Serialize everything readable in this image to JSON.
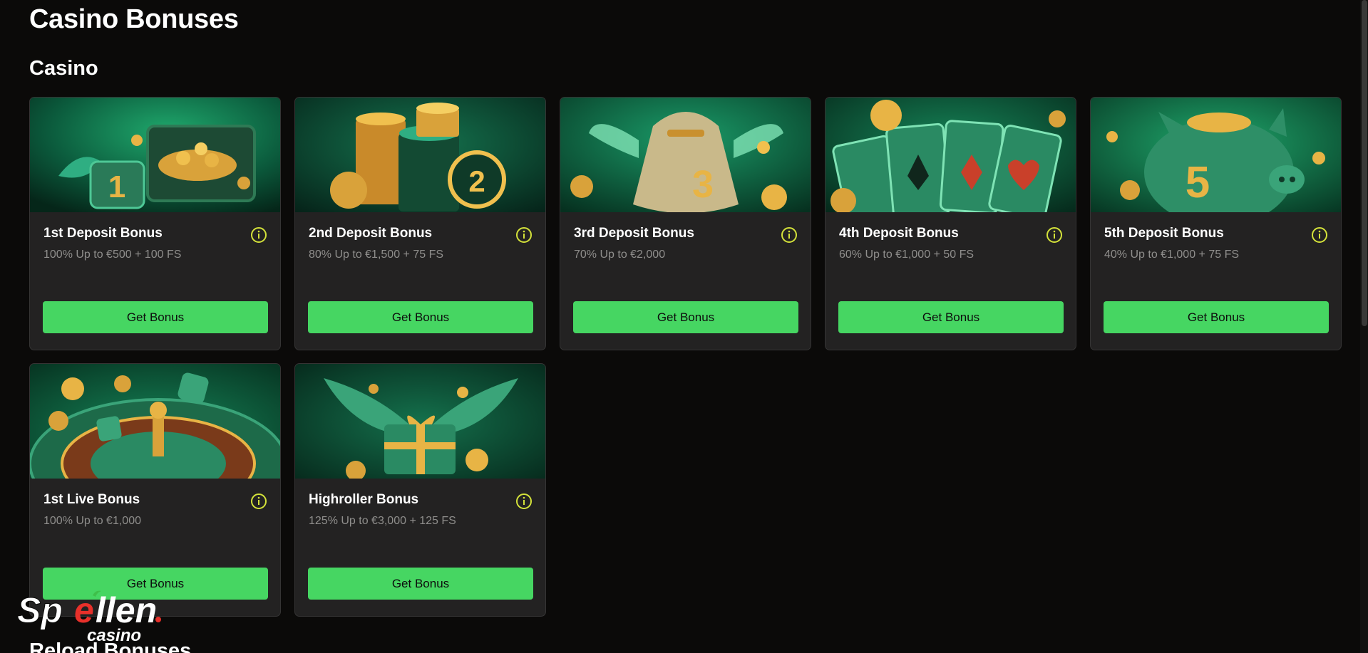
{
  "page": {
    "title": "Casino Bonuses",
    "section_casino": "Casino",
    "section_reload": "Reload Bonuses"
  },
  "cards": [
    {
      "name": "1st Deposit Bonus",
      "description": "100% Up to €500 + 100 FS",
      "button": "Get Bonus",
      "image_digit": "1",
      "info_icon": "info-icon"
    },
    {
      "name": "2nd Deposit Bonus",
      "description": "80% Up to €1,500 + 75 FS",
      "button": "Get Bonus",
      "image_digit": "2",
      "info_icon": "info-icon"
    },
    {
      "name": "3rd Deposit Bonus",
      "description": "70% Up to €2,000",
      "button": "Get Bonus",
      "image_digit": "3",
      "info_icon": "info-icon"
    },
    {
      "name": "4th Deposit Bonus",
      "description": "60% Up to €1,000 + 50 FS",
      "button": "Get Bonus",
      "image_digit": "",
      "info_icon": "info-icon"
    },
    {
      "name": "5th Deposit Bonus",
      "description": "40% Up to €1,000 + 75 FS",
      "button": "Get Bonus",
      "image_digit": "5",
      "info_icon": "info-icon"
    },
    {
      "name": "1st Live Bonus",
      "description": "100% Up to €1,000",
      "button": "Get Bonus",
      "image_digit": "",
      "info_icon": "info-icon"
    },
    {
      "name": "Highroller Bonus",
      "description": "125% Up to €3,000 + 125 FS",
      "button": "Get Bonus",
      "image_digit": "",
      "info_icon": "info-icon"
    }
  ],
  "watermark": {
    "brand": "Spellen",
    "sub": "casino"
  },
  "colors": {
    "background": "#0b0a09",
    "card": "#232222",
    "accent_green": "#46d662",
    "info_icon": "#d4e23a",
    "muted_text": "#8f8e8c"
  }
}
